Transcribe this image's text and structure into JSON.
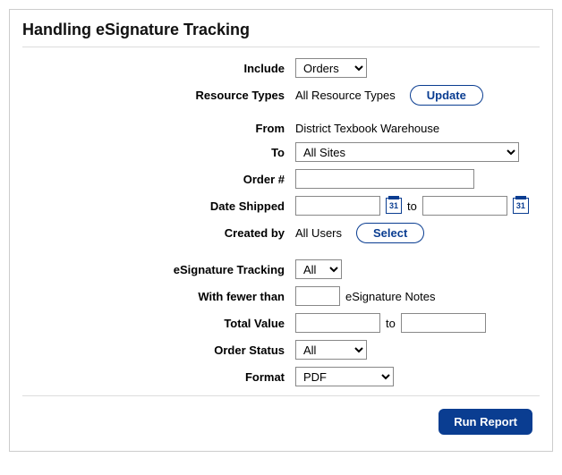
{
  "title": "Handling eSignature Tracking",
  "labels": {
    "include": "Include",
    "resource_types": "Resource Types",
    "from": "From",
    "to": "To",
    "order_num": "Order #",
    "date_shipped": "Date Shipped",
    "created_by": "Created by",
    "esig_tracking": "eSignature Tracking",
    "with_fewer": "With fewer than",
    "total_value": "Total Value",
    "order_status": "Order Status",
    "format": "Format"
  },
  "values": {
    "include": "Orders",
    "resource_types": "All Resource Types",
    "from": "District Texbook Warehouse",
    "to": "All Sites",
    "order_num": "",
    "date_from": "",
    "date_to": "",
    "created_by": "All Users",
    "esig_tracking": "All",
    "fewer_than": "",
    "total_from": "",
    "total_to": "",
    "order_status": "All",
    "format": "PDF",
    "cal_day": "31"
  },
  "text": {
    "to_sep": "to",
    "esig_notes": "eSignature Notes"
  },
  "buttons": {
    "update": "Update",
    "select": "Select",
    "run": "Run Report"
  }
}
